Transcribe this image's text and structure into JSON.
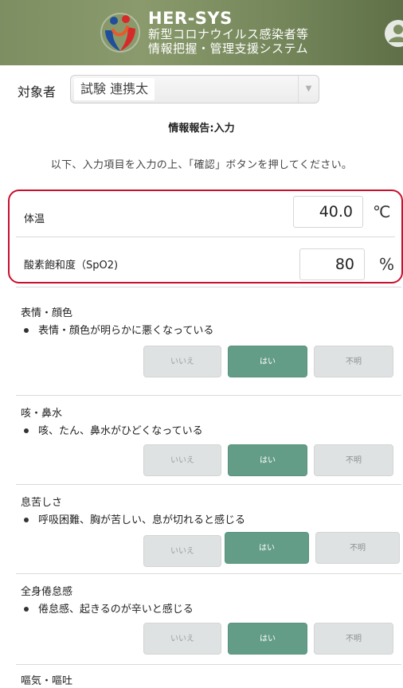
{
  "header": {
    "app_name": "HER-SYS",
    "subtitle_line1": "新型コロナウイルス感染者等",
    "subtitle_line2": "情報把握・管理支援システム",
    "background_color": "#7d8f62"
  },
  "subject": {
    "label": "対象者",
    "selected_value": "試験 連携太"
  },
  "page": {
    "section_title": "情報報告:入力",
    "instruction": "以下、入力項目を入力の上、「確認」ボタンを押してください。"
  },
  "vitals": {
    "highlight_color": "#c8102e",
    "temperature": {
      "label": "体温",
      "value": "40.0",
      "unit": "℃"
    },
    "spo2": {
      "label": "酸素飽和度（SpO2)",
      "value": "80",
      "unit": "%"
    }
  },
  "choice_labels": {
    "no": "いいえ",
    "yes": "はい",
    "unknown": "不明"
  },
  "symptoms": [
    {
      "title": "表情・顔色",
      "description": "表情・顔色が明らかに悪くなっている",
      "selected": "yes"
    },
    {
      "title": "咳・鼻水",
      "description": "咳、たん、鼻水がひどくなっている",
      "selected": "yes"
    },
    {
      "title": "息苦しさ",
      "description": "呼吸困難、胸が苦しい、息が切れると感じる",
      "selected": "yes"
    },
    {
      "title": "全身倦怠感",
      "description": "倦怠感、起きるのが辛いと感じる",
      "selected": "yes"
    },
    {
      "title": "嘔気・嘔吐",
      "description": "",
      "selected": ""
    }
  ],
  "colors": {
    "selected_button": "#639d88",
    "unselected_button": "#dfe2e2"
  }
}
